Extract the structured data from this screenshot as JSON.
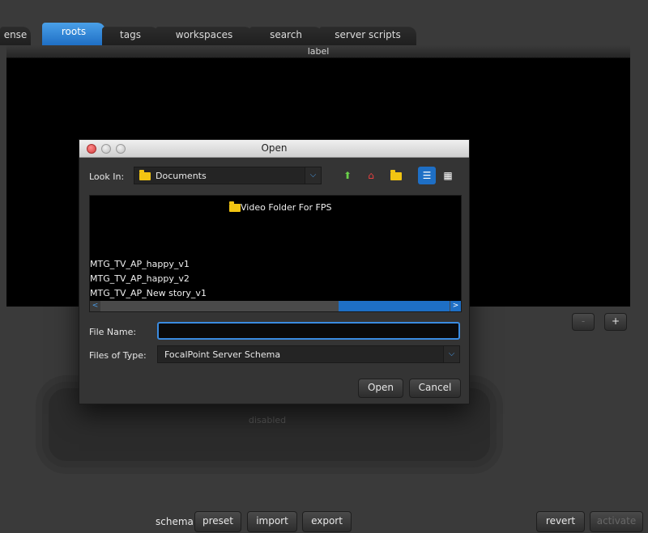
{
  "tabs": [
    {
      "label": "ense"
    },
    {
      "label": "roots"
    },
    {
      "label": "tags"
    },
    {
      "label": "workspaces"
    },
    {
      "label": "search"
    },
    {
      "label": "server scripts"
    }
  ],
  "table": {
    "header_label": "label"
  },
  "list_controls": {
    "minus": "-",
    "plus": "+"
  },
  "lower": {
    "status_text": "disabled"
  },
  "bottom": {
    "schema_label": "schema",
    "preset": "preset",
    "import": "import",
    "export": "export",
    "revert": "revert",
    "activate": "activate"
  },
  "dialog": {
    "title": "Open",
    "look_in_label": "Look In:",
    "look_in_value": "Documents",
    "files": {
      "top_folder": "Video Folder For FPS",
      "items": [
        "MTG_TV_AP_happy_v1",
        "MTG_TV_AP_happy_v2",
        "MTG_TV_AP_New story_v1"
      ]
    },
    "file_name_label": "File Name:",
    "file_name_value": "",
    "files_of_type_label": "Files of Type:",
    "files_of_type_value": "FocalPoint Server Schema",
    "open_button": "Open",
    "cancel_button": "Cancel"
  },
  "colors": {
    "accent": "#1e6fc5",
    "focus": "#3a8be0",
    "background": "#3a3a3a"
  }
}
